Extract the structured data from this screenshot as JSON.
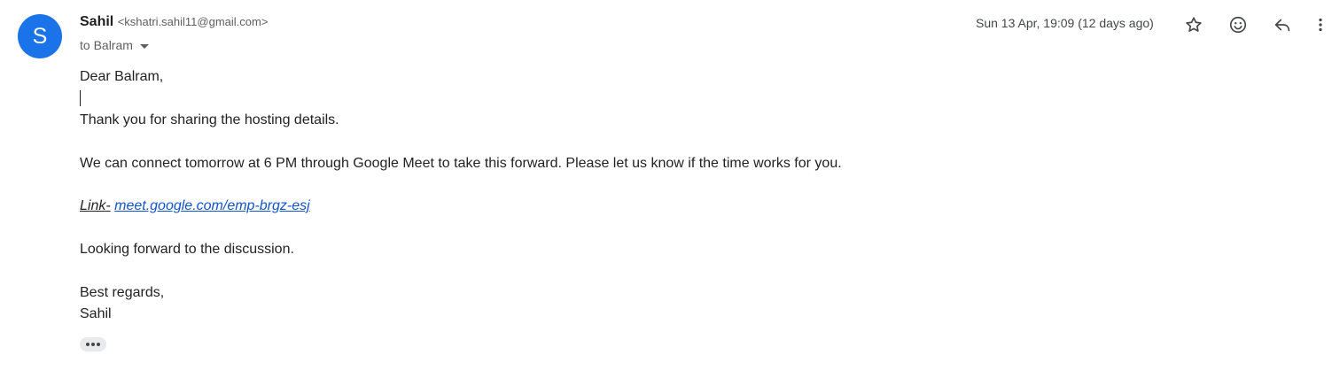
{
  "header": {
    "avatar_letter": "S",
    "avatar_color": "#1a73e8",
    "sender_name": "Sahil",
    "sender_email": "<kshatri.sahil11@gmail.com>",
    "recipient_line": "to Balram",
    "timestamp": "Sun 13 Apr, 19:09 (12 days ago)",
    "icons": [
      "star-icon",
      "emoji-icon",
      "reply-icon",
      "more-vert-icon"
    ]
  },
  "body": {
    "greeting": "Dear Balram,",
    "line_thanks": "Thank you for sharing the hosting details.",
    "line_meeting": "We can connect tomorrow at 6 PM through Google Meet to take this forward. Please let us know if the time works for you.",
    "link_label": "Link-",
    "link_text": "meet.google.com/emp-brgz-esj",
    "line_looking": "Looking forward to the discussion.",
    "signoff": "Best regards,",
    "signature": "Sahil",
    "link_color": "#1155cc"
  }
}
